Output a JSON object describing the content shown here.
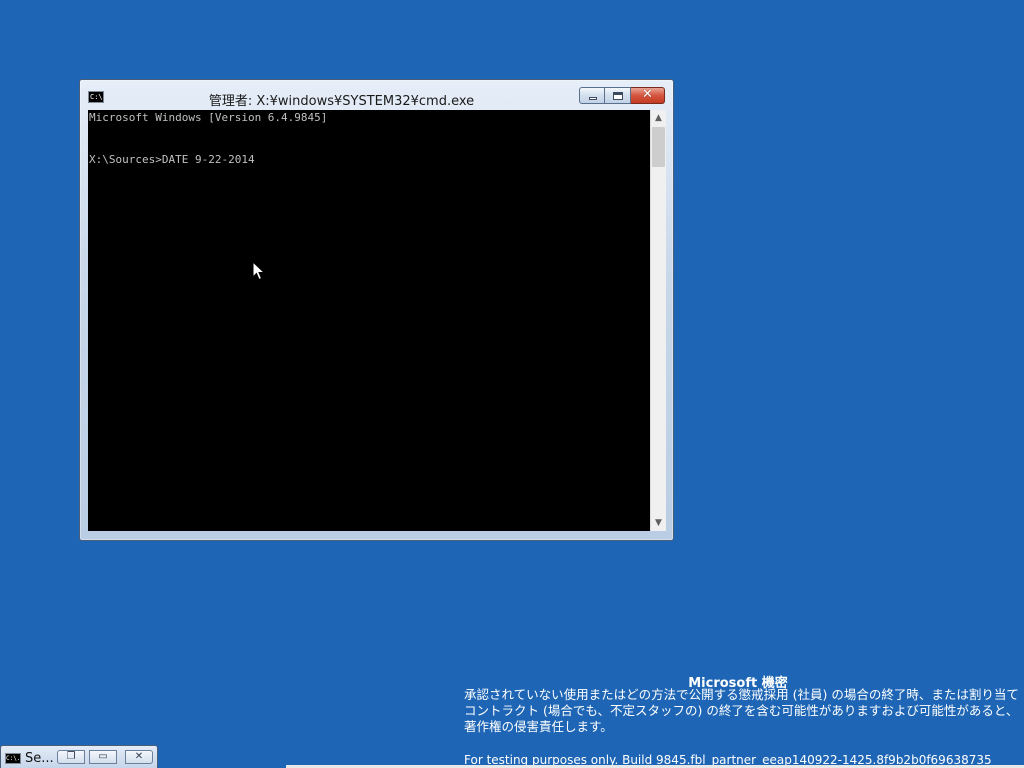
{
  "desktop": {
    "background_color": "#1e66b5"
  },
  "cmd_window": {
    "title": "管理者: X:¥windows¥SYSTEM32¥cmd.exe",
    "icon_label": "C:\\.",
    "console_lines": [
      "Microsoft Windows [Version 6.4.9845]",
      "",
      "X:\\Sources>DATE 9-22-2014"
    ],
    "caption_buttons": {
      "minimize": "minimize",
      "maximize": "maximize",
      "close": "✕"
    },
    "scrollbar": {
      "up_arrow": "▲",
      "down_arrow": "▼"
    }
  },
  "watermark": {
    "heading": "Microsoft 機密",
    "body": "承認されていない使用またはどの方法で公開する懲戒採用 (社員) の場合の終了時、または割り当てコントラクト (場合でも、不定スタッフの) の終了を含む可能性がありますおよび可能性があると、著作権の侵害責任します。",
    "build": "For testing purposes only. Build 9845.fbl_partner_eeap140922-1425.8f9b2b0f69638735"
  },
  "minimized_window": {
    "title": "Se...",
    "icon_label": "C:\\.",
    "restore_symbol": "❐",
    "maximize_symbol": "▭",
    "close_symbol": "✕"
  }
}
